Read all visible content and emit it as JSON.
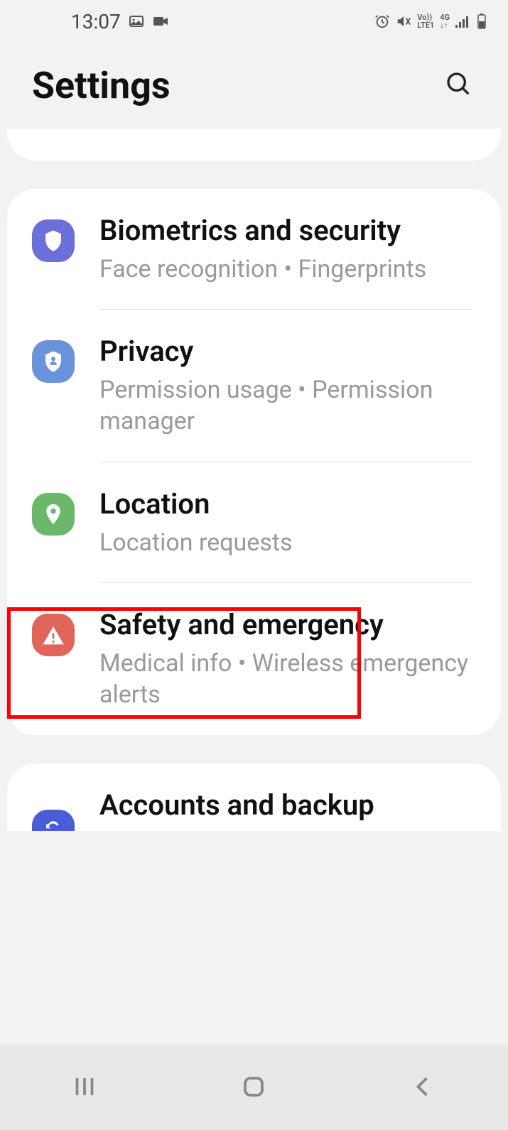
{
  "status": {
    "time": "13:07"
  },
  "header": {
    "title": "Settings"
  },
  "items": [
    {
      "title": "Biometrics and security",
      "subtitle": "Face recognition  •  Fingerprints"
    },
    {
      "title": "Privacy",
      "subtitle": "Permission usage  •  Permission manager"
    },
    {
      "title": "Location",
      "subtitle": "Location requests"
    },
    {
      "title": "Safety and emergency",
      "subtitle": "Medical info  •  Wireless emergency alerts"
    }
  ],
  "accounts": {
    "title": "Accounts and backup"
  }
}
